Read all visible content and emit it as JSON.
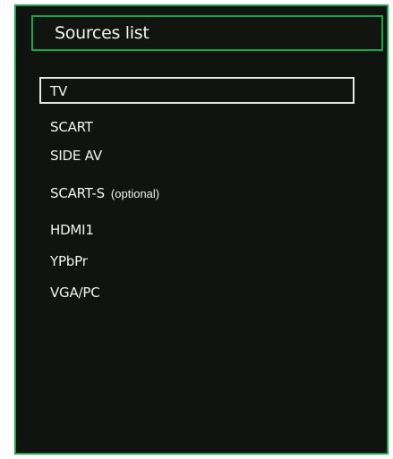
{
  "title": "Sources list",
  "colors": {
    "panel_background": "#111311",
    "accent_border": "#16a64a",
    "selection_border": "#e6e6e6",
    "text": "#f2f2f2"
  },
  "sources": [
    {
      "label": "TV",
      "note": "",
      "selected": true
    },
    {
      "label": "SCART",
      "note": "",
      "selected": false
    },
    {
      "label": "SIDE AV",
      "note": "",
      "selected": false
    },
    {
      "label": "SCART-S",
      "note": "(optional)",
      "selected": false
    },
    {
      "label": "HDMI1",
      "note": "",
      "selected": false
    },
    {
      "label": "YPbPr",
      "note": "",
      "selected": false
    },
    {
      "label": "VGA/PC",
      "note": "",
      "selected": false
    }
  ]
}
